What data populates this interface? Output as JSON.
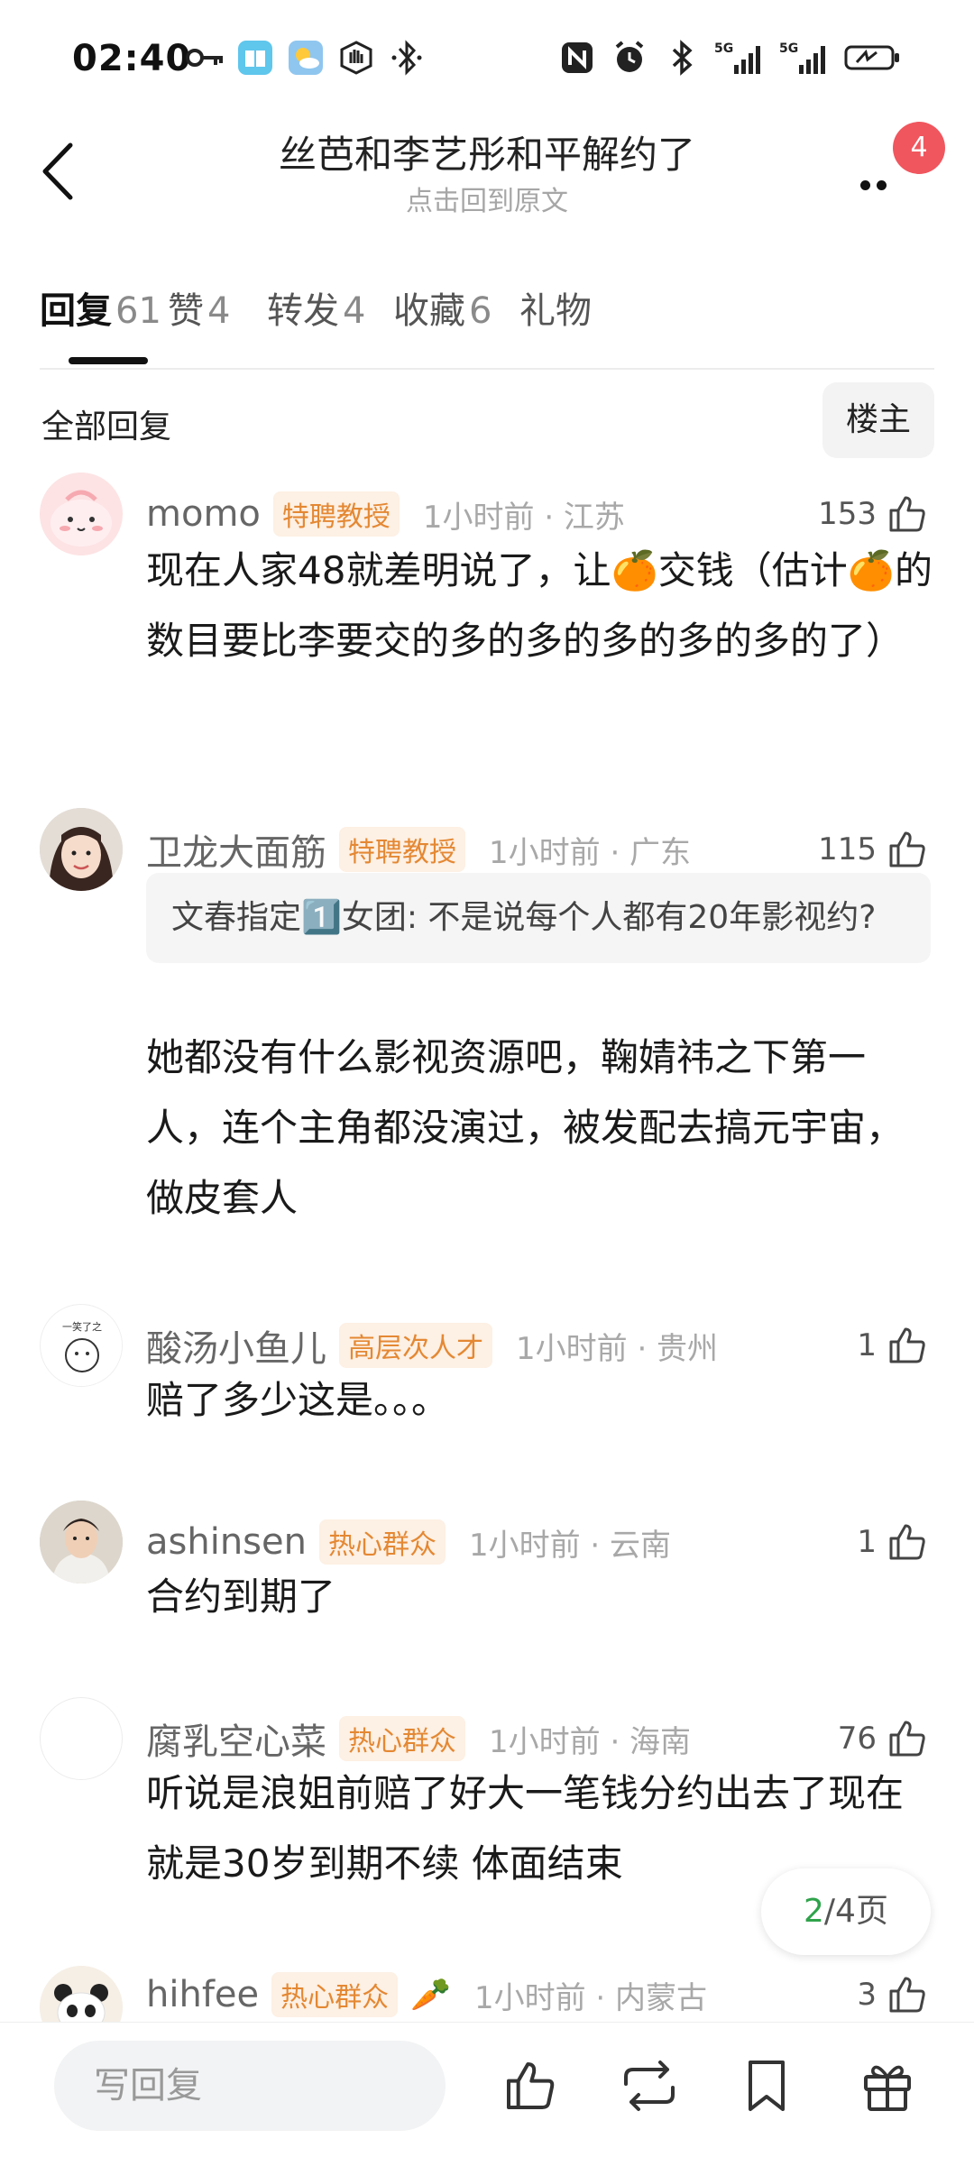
{
  "status_bar": {
    "time": "02:40",
    "left_icons": [
      "key-icon",
      "book-app-icon",
      "weather-app-icon",
      "hand-icon",
      "bluetooth-dots-icon"
    ],
    "right_icons": [
      "nfc-icon",
      "alarm-icon",
      "bluetooth-icon",
      "signal-5g-icon",
      "signal-5g-icon",
      "battery-charging-icon"
    ],
    "network_1": "5G",
    "network_2": "5G"
  },
  "header": {
    "title": "丝芭和李艺彤和平解约了",
    "subtitle": "点击回到原文",
    "notification_count": "4"
  },
  "tabs": [
    {
      "label": "回复",
      "count": "61",
      "active": true
    },
    {
      "label": "赞",
      "count": "4",
      "active": false
    },
    {
      "label": "转发",
      "count": "4",
      "active": false
    },
    {
      "label": "收藏",
      "count": "6",
      "active": false
    },
    {
      "label": "礼物",
      "count": "",
      "active": false
    }
  ],
  "filter": {
    "label": "全部回复",
    "op_button": "楼主"
  },
  "comments": [
    {
      "username": "momo",
      "tag": "特聘教授",
      "meta": "1小时前 · 江苏",
      "likes": "153",
      "text": "现在人家48就差明说了，让🍊交钱（估计🍊的数目要比李要交的多的多的多的多的多的了）"
    },
    {
      "username": "卫龙大面筋",
      "tag": "特聘教授",
      "meta": "1小时前 · 广东",
      "likes": "115",
      "quote": "文春指定1️⃣女团: 不是说每个人都有20年影视约?",
      "text": "她都没有什么影视资源吧，鞠婧祎之下第一人，连个主角都没演过，被发配去搞元宇宙，做皮套人"
    },
    {
      "username": "酸汤小鱼儿",
      "tag": "高层次人才",
      "meta": "1小时前 · 贵州",
      "likes": "1",
      "avatar_text": "一笑了之",
      "text": "赔了多少这是。。。"
    },
    {
      "username": "ashinsen",
      "tag": "热心群众",
      "meta": "1小时前 · 云南",
      "likes": "1",
      "text": "合约到期了"
    },
    {
      "username": "腐乳空心菜",
      "tag": "热心群众",
      "meta": "1小时前 · 海南",
      "likes": "76",
      "text": "听说是浪姐前赔了好大一笔钱分约出去了现在就是30岁到期不续 体面结束"
    },
    {
      "username": "hihfee",
      "tag": "热心群众",
      "meta": "1小时前 · 内蒙古",
      "likes": "3",
      "extra_icon": "🥕"
    }
  ],
  "pagination": {
    "current": "2",
    "total_text": "/4页"
  },
  "bottom_bar": {
    "reply_placeholder": "写回复",
    "actions": [
      "like-icon",
      "repost-icon",
      "bookmark-icon",
      "gift-icon"
    ]
  }
}
